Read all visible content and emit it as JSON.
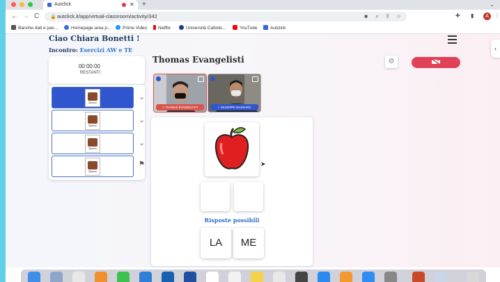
{
  "browser": {
    "tab_title": "Autclick",
    "tab_close": "✕",
    "new_tab": "+",
    "tab_menu": "⌄",
    "url": "autclick.it/app/virtual-classroom/activity/342",
    "profile_initial": "A",
    "nav": {
      "back": "←",
      "forward": "→",
      "reload": "C"
    },
    "bookmarks": [
      {
        "label": "Banche dati e pac...",
        "color": "#555555"
      },
      {
        "label": "Homepage area p...",
        "color": "#3b6fd8"
      },
      {
        "label": "Prime Video",
        "color": "#1a98ff"
      },
      {
        "label": "Netflix",
        "color": "#e50914"
      },
      {
        "label": "Università Cattolic...",
        "color": "#1c3f8f"
      },
      {
        "label": "YouTube",
        "color": "#ff0000"
      },
      {
        "label": "Autclick",
        "color": "#2e6bd8"
      }
    ]
  },
  "header": {
    "greeting": "Ciao Chiara Bonetti !",
    "encounter_label": "Incontro:",
    "encounter_value": "Esercizi AW e TE",
    "student_name": "Thomas Evangelisti"
  },
  "timer": {
    "value": "00:00:00",
    "label": "RESTANTI"
  },
  "activity_slots": [
    {
      "caption": "Spesso",
      "active": true,
      "end": "chevron"
    },
    {
      "caption": "Spesso",
      "active": false,
      "end": "chevron"
    },
    {
      "caption": "Spesso",
      "active": false,
      "end": "chevron"
    },
    {
      "caption": "Spesso",
      "active": false,
      "end": "flag"
    }
  ],
  "participants": [
    {
      "name": "THOMAS EVANGELISTI",
      "bar_color": "#d9534f",
      "border": "#d9534f"
    },
    {
      "name": "GIUSEPPE MASSARO",
      "bar_color": "#2f56cc",
      "border": "#2f56cc"
    }
  ],
  "exercise": {
    "picture": "apple",
    "answer_slots": 2,
    "options_label": "Risposte possibili",
    "options": [
      "LA",
      "ME"
    ]
  },
  "icons": {
    "settings": "⚙",
    "camera_off": "▶̸",
    "sidebar_toggle": "‹",
    "check": "✔",
    "radio": "○"
  },
  "colors": {
    "primary": "#2f56cc",
    "danger": "#e04058",
    "heading": "#1f3b5c"
  }
}
